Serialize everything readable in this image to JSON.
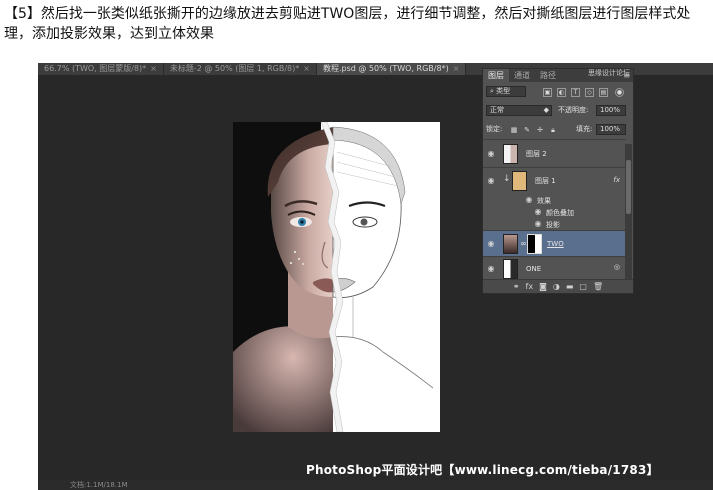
{
  "caption": {
    "line1": "【5】然后找一张类似纸张撕开的边缘放进去剪贴进TWO图层，进行细节调整，然后对撕纸图层进行图层样式处",
    "line2": "理，添加投影效果，达到立体效果"
  },
  "tabs": [
    {
      "label": "66.7% (TWO, 图层蒙版/8)*",
      "close": "×"
    },
    {
      "label": "未标题-2 @ 50% (图层 1, RGB/8)*",
      "close": "×"
    },
    {
      "label": "教程.psd @ 50% (TWO, RGB/8*)",
      "close": "×"
    }
  ],
  "layers_panel": {
    "tabs": [
      "图层",
      "通道",
      "路径"
    ],
    "top_right": "思缘设计论坛",
    "filter_label": "类型",
    "blend_mode": "正常",
    "opacity_label": "不透明度:",
    "opacity_value": "100%",
    "lock_label": "锁定:",
    "fill_label": "填充:",
    "fill_value": "100%",
    "layers": [
      {
        "name": "图层 2"
      },
      {
        "name": "图层 1",
        "fx": "fx"
      },
      {
        "name": "效果"
      },
      {
        "name": "颜色叠加"
      },
      {
        "name": "投影"
      },
      {
        "name": "TWO"
      },
      {
        "name": "ONE"
      }
    ],
    "bottom_icons": [
      "link-icon",
      "fx-icon",
      "mask-icon",
      "adjustment-icon",
      "folder-icon",
      "new-layer-icon",
      "trash-icon"
    ]
  },
  "status_text": "文档:1.1M/18.1M",
  "watermark": "PhotoShop平面设计吧【www.linecg.com/tieba/1783】",
  "colors": {
    "app_bg": "#282828",
    "panel_bg": "#535353",
    "selected_layer": "#5a6f8e"
  }
}
